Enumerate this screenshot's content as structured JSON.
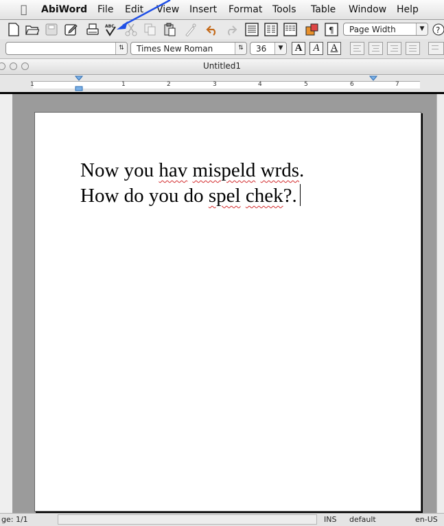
{
  "menubar": {
    "app_name": "AbiWord",
    "items": [
      "File",
      "Edit",
      "View",
      "Insert",
      "Format",
      "Tools",
      "Table",
      "Window",
      "Help"
    ]
  },
  "toolbar": {
    "zoom": "Page Width",
    "style": "",
    "font": "Times New Roman",
    "font_size": "36",
    "bold_label": "A",
    "italic_label": "A",
    "underline_label": "A",
    "pilcrow": "¶",
    "help_glyph": "?"
  },
  "window": {
    "title": "Untitled1"
  },
  "ruler": {
    "numbers": [
      "1",
      "1",
      "2",
      "3",
      "4",
      "5",
      "6",
      "7"
    ]
  },
  "document": {
    "lines": [
      [
        {
          "text": "Now you ",
          "misspelled": false
        },
        {
          "text": "hav",
          "misspelled": true
        },
        {
          "text": " ",
          "misspelled": false
        },
        {
          "text": "mispeld",
          "misspelled": true
        },
        {
          "text": " ",
          "misspelled": false
        },
        {
          "text": "wrds",
          "misspelled": true
        },
        {
          "text": ".",
          "misspelled": false
        }
      ],
      [
        {
          "text": "How do you do ",
          "misspelled": false
        },
        {
          "text": "spel",
          "misspelled": true
        },
        {
          "text": " ",
          "misspelled": false
        },
        {
          "text": "chek",
          "misspelled": true
        },
        {
          "text": "?.",
          "misspelled": false
        }
      ]
    ]
  },
  "status": {
    "page": "ge: 1/1",
    "mode": "INS",
    "style": "default",
    "language": "en-US"
  },
  "colors": {
    "annotation_arrow": "#1f4fe6",
    "spell_underline": "#d2282a",
    "workspace": "#9b9b9b"
  }
}
